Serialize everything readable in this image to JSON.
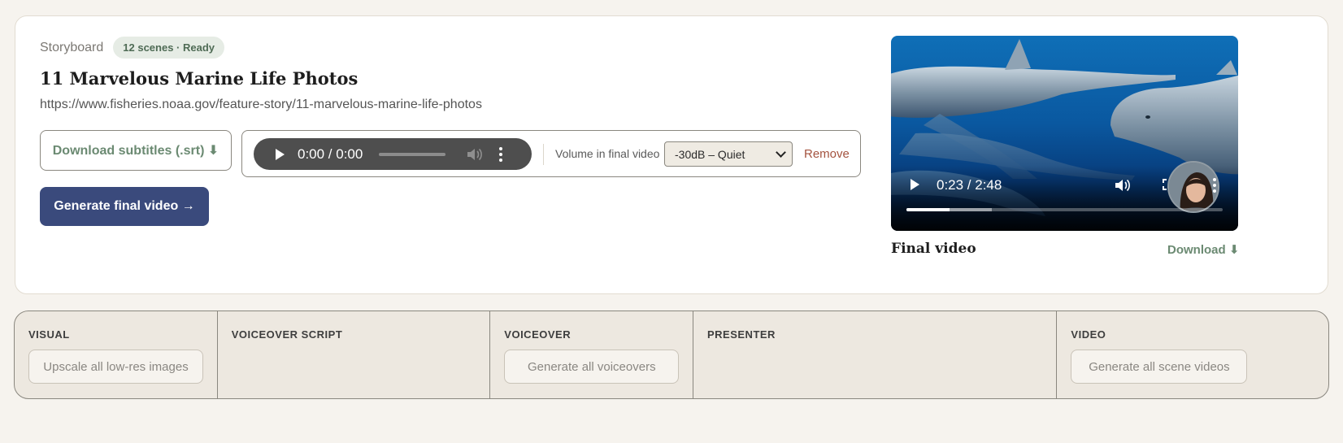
{
  "storyboard": {
    "label": "Storyboard",
    "badge": "12 scenes · Ready",
    "title": "11 Marvelous Marine Life Photos",
    "url": "https://www.fisheries.noaa.gov/feature-story/11-marvelous-marine-life-photos",
    "download_subtitles_label": "Download subtitles (.srt) ⬇",
    "generate_label": "Generate final video →"
  },
  "audio": {
    "time": "0:00 / 0:00",
    "volume_label": "Volume in final video",
    "volume_selected": "-30dB – Quiet",
    "remove_label": "Remove"
  },
  "video": {
    "time": "0:23 / 2:48",
    "progress_fraction": 0.137,
    "buffered_fraction": 0.27,
    "caption": "Final video",
    "download_label": "Download ⬇"
  },
  "columns": [
    {
      "title": "VISUAL",
      "button": "Upscale all low-res images"
    },
    {
      "title": "VOICEOVER SCRIPT",
      "button": ""
    },
    {
      "title": "VOICEOVER",
      "button": "Generate all voiceovers"
    },
    {
      "title": "PRESENTER",
      "button": ""
    },
    {
      "title": "VIDEO",
      "button": "Generate all scene videos"
    }
  ],
  "colors": {
    "background": "#f6f3ee",
    "primary_button": "#3a4a7c",
    "accent_green": "#6b8a72",
    "remove_red": "#a4533f"
  }
}
